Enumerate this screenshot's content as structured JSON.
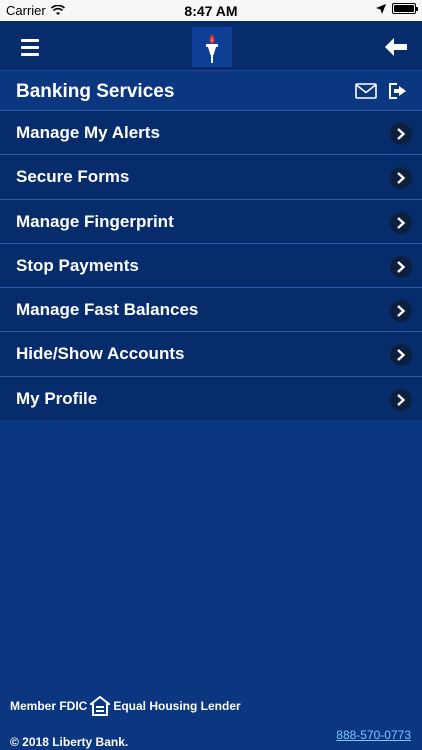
{
  "status_bar": {
    "carrier": "Carrier",
    "time": "8:47 AM"
  },
  "header": {
    "menu_icon": "hamburger-icon",
    "logo_icon": "torch-logo",
    "back_icon": "back-arrow-icon"
  },
  "section": {
    "title": "Banking Services",
    "mail_icon": "envelope-icon",
    "logout_icon": "logout-icon"
  },
  "menu_items": [
    {
      "label": "Manage My Alerts"
    },
    {
      "label": "Secure Forms"
    },
    {
      "label": "Manage Fingerprint"
    },
    {
      "label": "Stop Payments"
    },
    {
      "label": "Manage Fast Balances"
    },
    {
      "label": "Hide/Show Accounts"
    },
    {
      "label": "My Profile"
    }
  ],
  "footer": {
    "member": "Member FDIC",
    "equal_housing": "Equal Housing Lender",
    "copyright": "© 2018 Liberty Bank.",
    "phone": "888-570-0773"
  },
  "colors": {
    "background": "#0b3680",
    "bar": "#062c6b",
    "link": "#7fc4ff"
  }
}
